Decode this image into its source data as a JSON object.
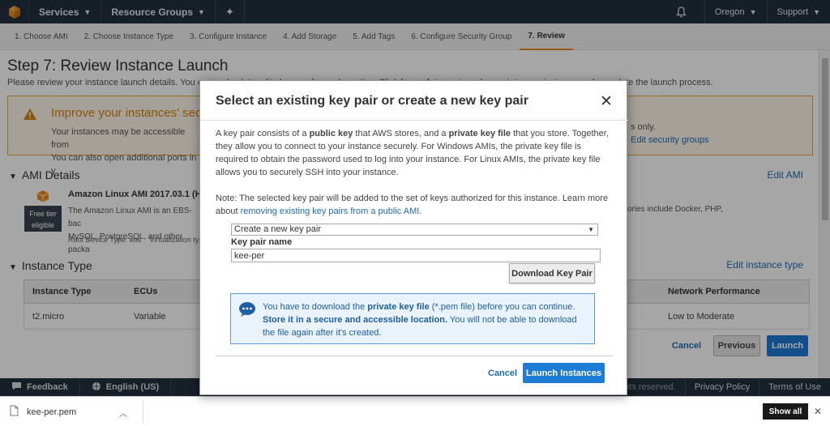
{
  "nav": {
    "services": "Services",
    "resource_groups": "Resource Groups",
    "region": "Oregon",
    "support": "Support"
  },
  "steps": [
    "1. Choose AMI",
    "2. Choose Instance Type",
    "3. Configure Instance",
    "4. Add Storage",
    "5. Add Tags",
    "6. Configure Security Group",
    "7. Review"
  ],
  "page": {
    "title": "Step 7: Review Instance Launch",
    "subtitle_start": "Please review your instance launch details. You can go back to edit changes for each section. Click ",
    "subtitle_bold": "Launch",
    "subtitle_end": " to assign a key pair to your instance and complete the launch process."
  },
  "warning": {
    "title": "Improve your instances' security",
    "line1": "Your instances may be accessible from",
    "line2": "You can also open additional ports in y",
    "right_line1": "s only.",
    "right_link": "Edit security groups"
  },
  "ami": {
    "section": "AMI Details",
    "edit": "Edit AMI",
    "free_tier_1": "Free tier",
    "free_tier_2": "eligible",
    "name": "Amazon Linux AMI 2017.03.1 (H",
    "desc1": "The Amazon Linux AMI is an EBS-bac",
    "desc2": "MySQL, PostgreSQL, and other packa",
    "desc_right": "ories include Docker, PHP,",
    "meta1": "Root Device Type: ebs",
    "meta2": "Virtualization type"
  },
  "instance": {
    "section": "Instance Type",
    "edit": "Edit instance type",
    "headers": [
      "Instance Type",
      "ECUs",
      "Network Performance"
    ],
    "row": [
      "t2.micro",
      "Variable",
      "Low to Moderate"
    ]
  },
  "actions": {
    "cancel": "Cancel",
    "previous": "Previous",
    "launch": "Launch"
  },
  "footer": {
    "feedback": "Feedback",
    "language": "English (US)",
    "rights": "All rights reserved.",
    "privacy": "Privacy Policy",
    "terms": "Terms of Use"
  },
  "download": {
    "file": "kee-per.pem",
    "show_all": "Show all"
  },
  "modal": {
    "title": "Select an existing key pair or create a new key pair",
    "p1_a": "A key pair consists of a ",
    "p1_b": "public key",
    "p1_c": " that AWS stores, and a ",
    "p1_d": "private key file",
    "p1_e": " that you store. Together, they allow you to connect to your instance securely. For Windows AMIs, the private key file is required to obtain the password used to log into your instance. For Linux AMIs, the private key file allows you to securely SSH into your instance.",
    "p2_a": "Note: The selected key pair will be added to the set of keys authorized for this instance. Learn more about ",
    "p2_link": "removing existing key pairs from a public AMI",
    "p2_c": ".",
    "select_value": "Create a new key pair",
    "kp_label": "Key pair name",
    "kp_value": "kee-per",
    "download_btn": "Download Key Pair",
    "info_a": "You have to download the ",
    "info_b": "private key file",
    "info_c": " (*.pem file) before you can continue. ",
    "info_d": "Store it in a secure and accessible location.",
    "info_e": " You will not be able to download the file again after it's created.",
    "cancel": "Cancel",
    "launch": "Launch Instances"
  },
  "colors": {
    "nav_bg": "#232f3e",
    "primary_blue": "#1e7bd6",
    "warning_orange": "#e88b1f"
  }
}
